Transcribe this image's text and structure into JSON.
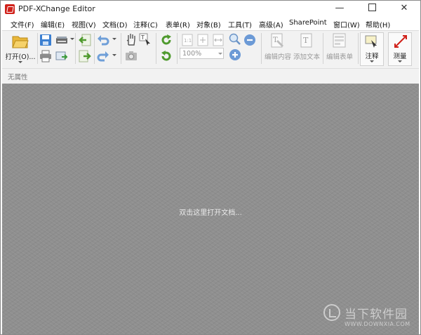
{
  "window": {
    "title": "PDF-XChange Editor",
    "minimize_glyph": "—",
    "close_glyph": "✕"
  },
  "menu": [
    {
      "label": "文件(F)"
    },
    {
      "label": "编辑(E)"
    },
    {
      "label": "视图(V)"
    },
    {
      "label": "文档(D)"
    },
    {
      "label": "注释(C)"
    },
    {
      "label": "表单(R)"
    },
    {
      "label": "对象(B)"
    },
    {
      "label": "工具(T)"
    },
    {
      "label": "高级(A)"
    },
    {
      "label": "SharePoint"
    },
    {
      "label": "窗口(W)"
    },
    {
      "label": "帮助(H)"
    }
  ],
  "toolbar": {
    "open_label": "打开(O)...",
    "zoom_value": "100%",
    "edit_content_label": "编辑内容",
    "add_text_label": "添加文本",
    "edit_form_label": "编辑表单",
    "comment_label": "注释",
    "measure_label": "测量"
  },
  "properties": {
    "label": "无属性"
  },
  "workspace": {
    "hint": "双击这里打开文档..."
  },
  "watermark": {
    "text": "当下软件园",
    "url": "WWW.DOWNXIA.COM"
  },
  "icons": {
    "folder": "folder-open-icon",
    "save": "save-icon",
    "print": "print-icon",
    "scan": "scanner-icon",
    "email": "email-icon",
    "back": "back-arrow-icon",
    "forward": "forward-arrow-icon",
    "undo": "undo-icon",
    "redo": "redo-icon",
    "hand": "hand-tool-icon",
    "select_text": "select-text-icon",
    "snapshot": "snapshot-icon",
    "rotate_cw": "rotate-clockwise-icon",
    "rotate_ccw": "rotate-counterclockwise-icon",
    "zoom_in": "zoom-in-icon",
    "zoom_out": "zoom-out-icon"
  },
  "colors": {
    "brand_red": "#d0211a",
    "workspace_gray": "#8f8f8f",
    "toolbar_bg": "#f2f2f2"
  }
}
